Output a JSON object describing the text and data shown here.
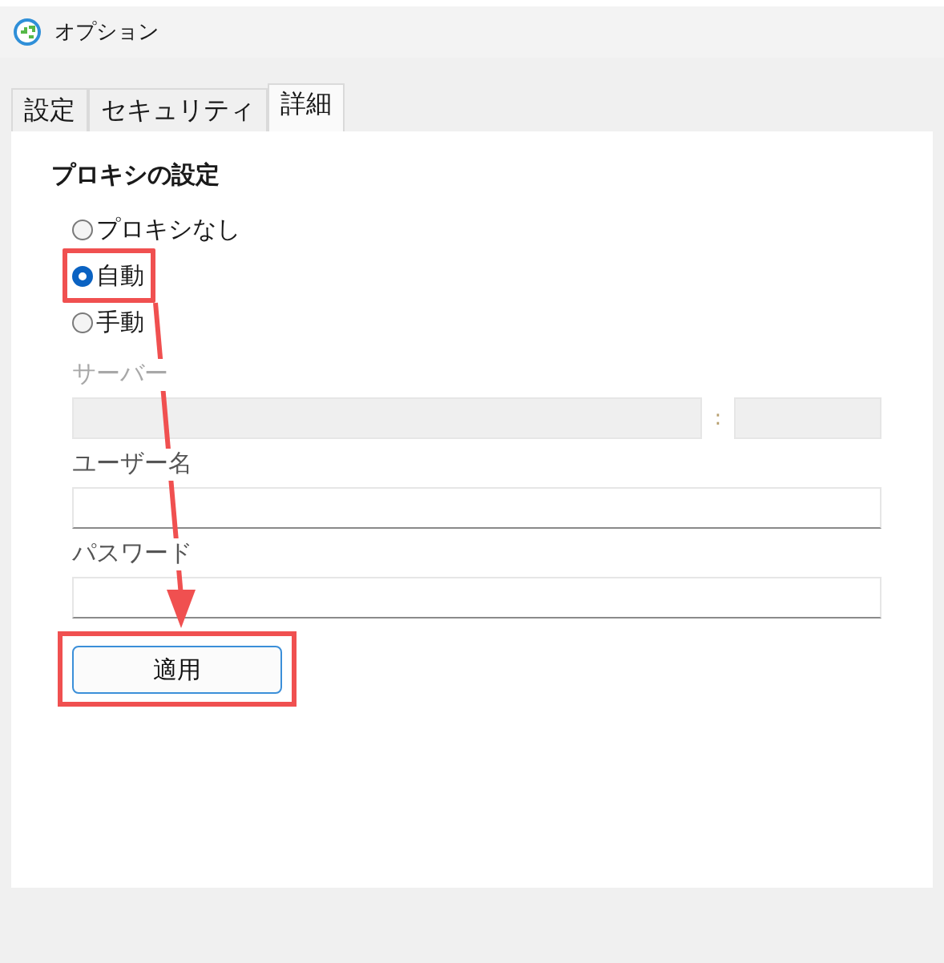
{
  "window": {
    "title": "オプション"
  },
  "tabs": [
    {
      "label": "設定",
      "selected": false
    },
    {
      "label": "セキュリティ",
      "selected": false
    },
    {
      "label": "詳細",
      "selected": true
    }
  ],
  "proxy": {
    "heading": "プロキシの設定",
    "options": [
      {
        "label": "プロキシなし",
        "selected": false,
        "highlighted": false
      },
      {
        "label": "自動",
        "selected": true,
        "highlighted": true
      },
      {
        "label": "手動",
        "selected": false,
        "highlighted": false
      }
    ],
    "server": {
      "label": "サーバー",
      "disabled": true,
      "separator": ":",
      "port_disabled": true
    },
    "username": {
      "label": "ユーザー名",
      "disabled": false
    },
    "password": {
      "label": "パスワード",
      "disabled": false
    },
    "apply_button": {
      "label": "適用",
      "highlighted": true
    }
  },
  "annotation": {
    "arrow": true,
    "color": "#f05050"
  }
}
